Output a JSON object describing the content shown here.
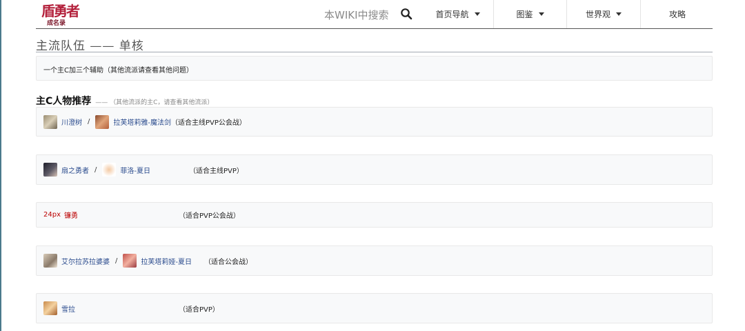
{
  "header": {
    "logo_top": "盾勇者",
    "logo_bottom": "成名录",
    "search_placeholder": "本WIKI中搜索",
    "nav": [
      {
        "label": "首页导航"
      },
      {
        "label": "图鉴"
      },
      {
        "label": "世界观"
      },
      {
        "label": "攻略"
      }
    ]
  },
  "page": {
    "title": "主流队伍 —— 单核",
    "intro": "一个主C加三个辅助（其他流派请查看其他问题）",
    "section_title": "主C人物推荐",
    "section_note": "—— （其他流派的主C，请查看其他流派）"
  },
  "rows": [
    {
      "char1": "川澄树",
      "sep": "/",
      "char2": "拉芙塔莉雅-魔法剑",
      "note": "（适合主线PVP公会战）"
    },
    {
      "char1": "扇之勇者",
      "sep": "/",
      "char2": "菲洛-夏日",
      "note": "（适合主线PVP）"
    },
    {
      "prefix": "24px",
      "char1": "镰勇",
      "note": "（适合PVP公会战）"
    },
    {
      "char1": "艾尔拉苏拉婆婆",
      "sep": "/",
      "char2": "拉芙塔莉娅-夏日",
      "note": "（适合公会战）"
    },
    {
      "char1": "雪拉",
      "note": "（适合PVP）"
    }
  ],
  "colors": {
    "link": "#2a4b8d",
    "logo_red": "#b3213c",
    "box_bg": "#f8f9fa"
  }
}
